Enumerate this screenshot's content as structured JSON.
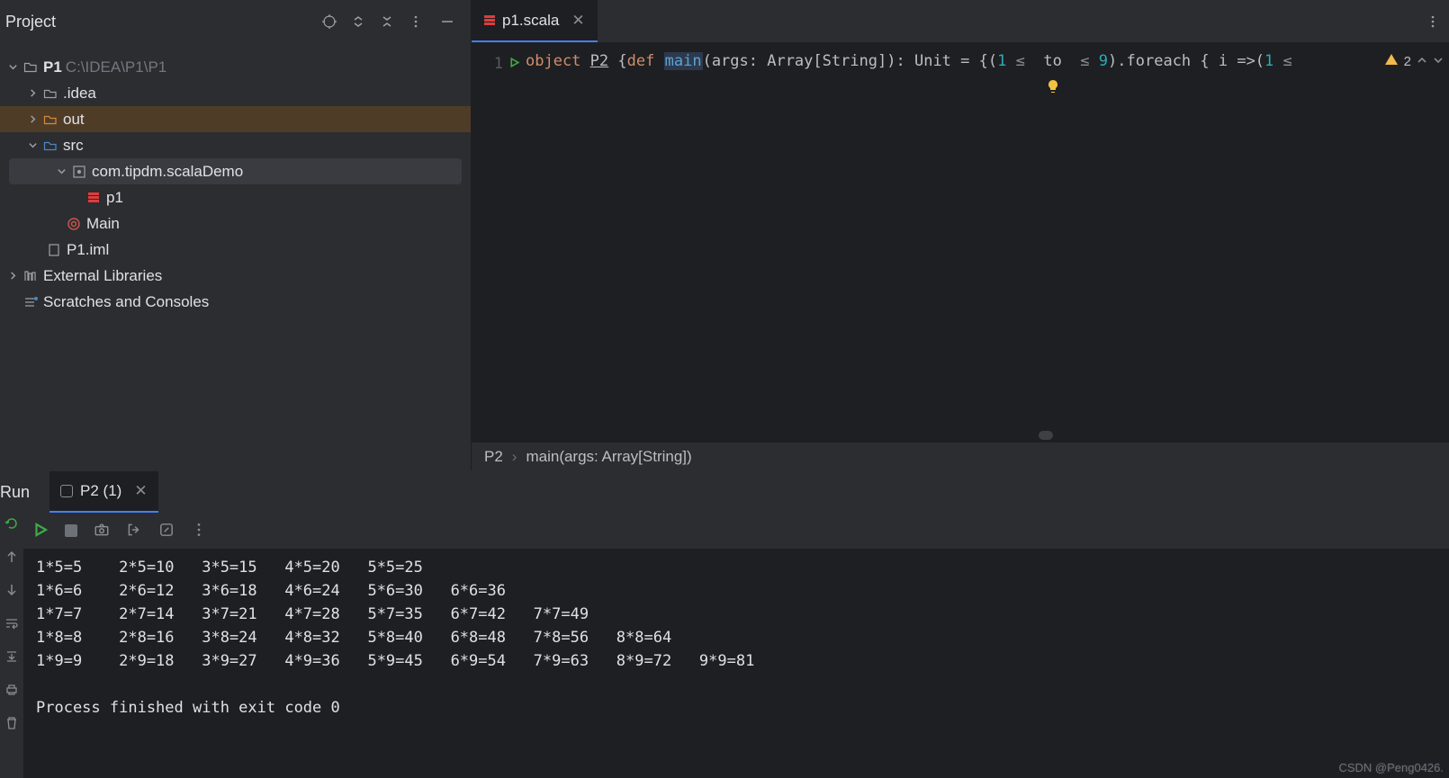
{
  "panel": {
    "title": "Project",
    "root": {
      "name": "P1",
      "path": "C:\\IDEA\\P1\\P1"
    },
    "items": {
      "idea": ".idea",
      "out": "out",
      "src": "src",
      "pkg": "com.tipdm.scalaDemo",
      "p1": "p1",
      "main": "Main",
      "iml": "P1.iml",
      "extlib": "External Libraries",
      "scratch": "Scratches and Consoles"
    }
  },
  "editor": {
    "tab": "p1.scala",
    "line_number": "1",
    "tokens": {
      "object": "object",
      "p2": "P2",
      "lbrace": "{",
      "def": "def",
      "main": "main",
      "sig": "(args: Array[String]): Unit = {(",
      "one_a": "1",
      "le_a": "≤",
      "to": "to",
      "le_b": "≤",
      "nine": "9",
      "chain": ").foreach { i =>(",
      "one_b": "1",
      "le_c": "≤"
    },
    "warning_count": "2",
    "breadcrumb_a": "P2",
    "breadcrumb_b": "main(args: Array[String])"
  },
  "run": {
    "title": "Run",
    "tab": "P2 (1)",
    "lines": [
      "1*5=5    2*5=10   3*5=15   4*5=20   5*5=25",
      "1*6=6    2*6=12   3*6=18   4*6=24   5*6=30   6*6=36",
      "1*7=7    2*7=14   3*7=21   4*7=28   5*7=35   6*7=42   7*7=49",
      "1*8=8    2*8=16   3*8=24   4*8=32   5*8=40   6*8=48   7*8=56   8*8=64",
      "1*9=9    2*9=18   3*9=27   4*9=36   5*9=45   6*9=54   7*9=63   8*9=72   9*9=81",
      "",
      "Process finished with exit code 0"
    ]
  },
  "watermark": "CSDN @Peng0426."
}
